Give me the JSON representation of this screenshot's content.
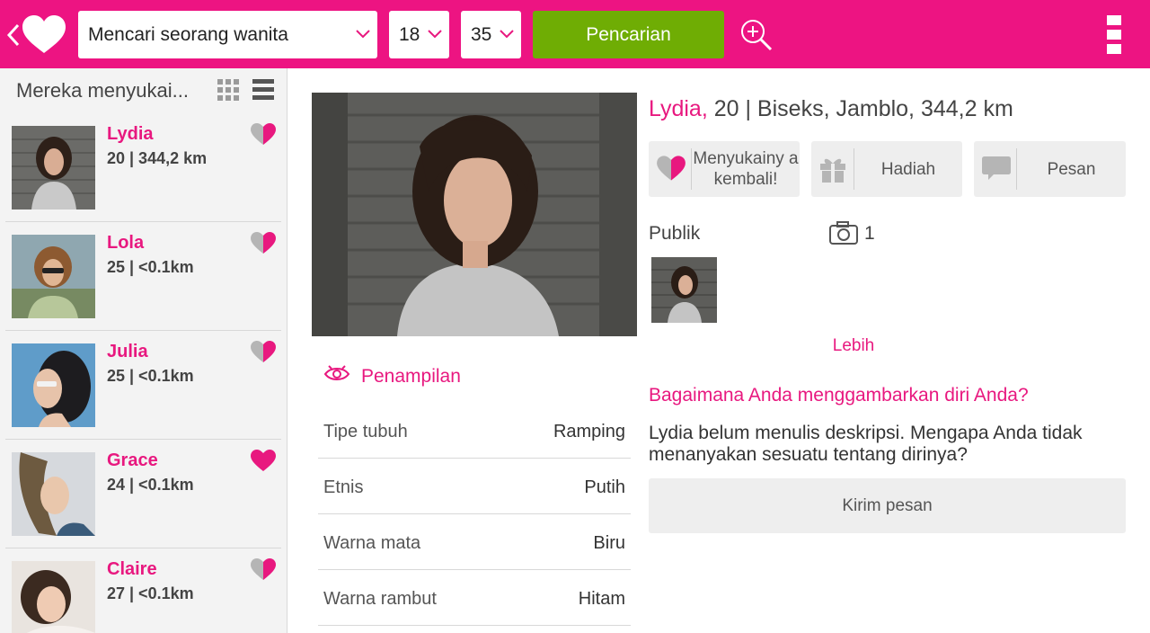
{
  "colors": {
    "brand_pink": "#ed1482",
    "search_green": "#6fad04",
    "heart_gray": "#b5b5b5"
  },
  "topbar": {
    "back_icon": "chevron-left-icon",
    "logo_icon": "heart-icon",
    "search_dropdown": "Mencari seorang wanita",
    "age_min": "18",
    "age_max": "35",
    "search_button": "Pencarian",
    "zoom_icon": "magnifier-plus-icon",
    "menu_icon": "overflow-menu-icon"
  },
  "sidebar": {
    "header": "Mereka menyukai...",
    "items": [
      {
        "name": "Lydia",
        "meta": "20 | 344,2 km",
        "liked": false
      },
      {
        "name": "Lola",
        "meta": "25 | <0.1km",
        "liked": false
      },
      {
        "name": "Julia",
        "meta": "25 | <0.1km",
        "liked": false
      },
      {
        "name": "Grace",
        "meta": "24 | <0.1km",
        "liked": true
      },
      {
        "name": "Claire",
        "meta": "27 | <0.1km",
        "liked": false
      }
    ]
  },
  "profile": {
    "name": "Lydia,",
    "details": " 20 | Biseks, Jamblo, 344,2 km",
    "actions": {
      "like_back": "Menyukainy a kembali!",
      "gift": "Hadiah",
      "message": "Pesan"
    },
    "public_label": "Publik",
    "photo_count": "1",
    "more": "Lebih",
    "question": "Bagaimana Anda menggambarkan diri Anda?",
    "description": "Lydia belum menulis deskripsi. Mengapa Anda tidak menanyakan sesuatu tentang dirinya?",
    "send_message": "Kirim pesan",
    "appearance_title": "Penampilan",
    "attributes": [
      {
        "key": "Tipe tubuh",
        "value": "Ramping"
      },
      {
        "key": "Etnis",
        "value": "Putih"
      },
      {
        "key": "Warna mata",
        "value": "Biru"
      },
      {
        "key": "Warna rambut",
        "value": "Hitam"
      }
    ]
  }
}
